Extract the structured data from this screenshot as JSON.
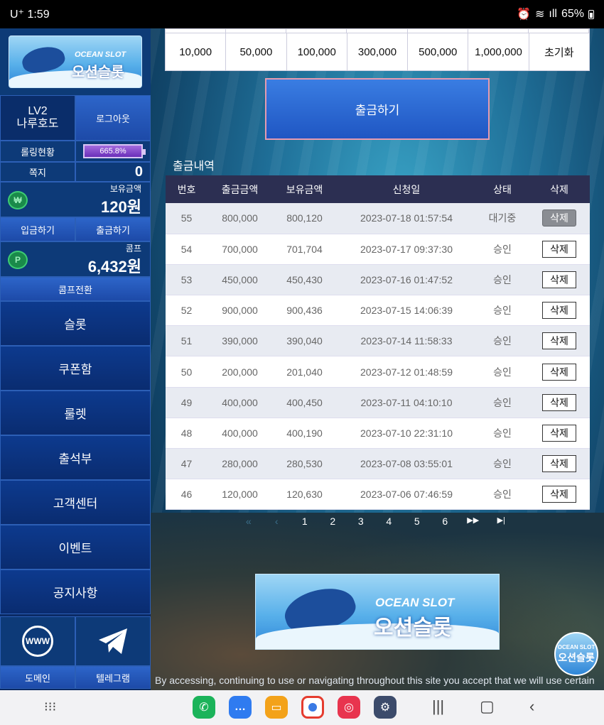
{
  "status": {
    "carrier": "U⁺",
    "time": "1:59",
    "battery": "65%"
  },
  "sidebar": {
    "logo_line1": "OCEAN SLOT",
    "logo_line2": "오션슬롯",
    "level": "LV2",
    "nickname": "나루호도",
    "logout": "로그아웃",
    "rolling_label": "롤링현황",
    "rolling_value": "665.8%",
    "note_label": "쪽지",
    "note_count": "0",
    "balance_label": "보유금액",
    "balance_value": "120원",
    "deposit": "입금하기",
    "withdraw": "출금하기",
    "comp_label": "콤프",
    "comp_value": "6,432원",
    "comp_switch": "콤프전환",
    "menu": [
      "슬롯",
      "쿠폰함",
      "룰렛",
      "출석부",
      "고객센터",
      "이벤트",
      "공지사항"
    ],
    "domain_label": "도메인",
    "telegram_label": "텔레그램",
    "www_icon": "WWW"
  },
  "amounts": [
    "10,000",
    "50,000",
    "100,000",
    "300,000",
    "500,000",
    "1,000,000",
    "초기화"
  ],
  "withdraw_button": "출금하기",
  "history": {
    "title": "출금내역",
    "headers": [
      "번호",
      "출금금액",
      "보유금액",
      "신청일",
      "상태",
      "삭제"
    ],
    "rows": [
      [
        "55",
        "800,000",
        "800,120",
        "2023-07-18 01:57:54",
        "대기중",
        "삭제"
      ],
      [
        "54",
        "700,000",
        "701,704",
        "2023-07-17 09:37:30",
        "승인",
        "삭제"
      ],
      [
        "53",
        "450,000",
        "450,430",
        "2023-07-16 01:47:52",
        "승인",
        "삭제"
      ],
      [
        "52",
        "900,000",
        "900,436",
        "2023-07-15 14:06:39",
        "승인",
        "삭제"
      ],
      [
        "51",
        "390,000",
        "390,040",
        "2023-07-14 11:58:33",
        "승인",
        "삭제"
      ],
      [
        "50",
        "200,000",
        "201,040",
        "2023-07-12 01:48:59",
        "승인",
        "삭제"
      ],
      [
        "49",
        "400,000",
        "400,450",
        "2023-07-11 04:10:10",
        "승인",
        "삭제"
      ],
      [
        "48",
        "400,000",
        "400,190",
        "2023-07-10 22:31:10",
        "승인",
        "삭제"
      ],
      [
        "47",
        "280,000",
        "280,530",
        "2023-07-08 03:55:01",
        "승인",
        "삭제"
      ],
      [
        "46",
        "120,000",
        "120,630",
        "2023-07-06 07:46:59",
        "승인",
        "삭제"
      ]
    ]
  },
  "pager": {
    "first": "«",
    "prev": "‹",
    "pages": [
      "1",
      "2",
      "3",
      "4",
      "5",
      "6"
    ],
    "next": "▶▶",
    "last": "▶|"
  },
  "banner": {
    "line1": "OCEAN SLOT",
    "line2": "오션슬롯"
  },
  "cookie_text": "By accessing, continuing to use or navigating throughout this site you accept that we will use certain",
  "colors": {
    "sidebar": "#0b2a64",
    "table_header": "#2c2f52",
    "accent_blue": "#1f56c3"
  }
}
